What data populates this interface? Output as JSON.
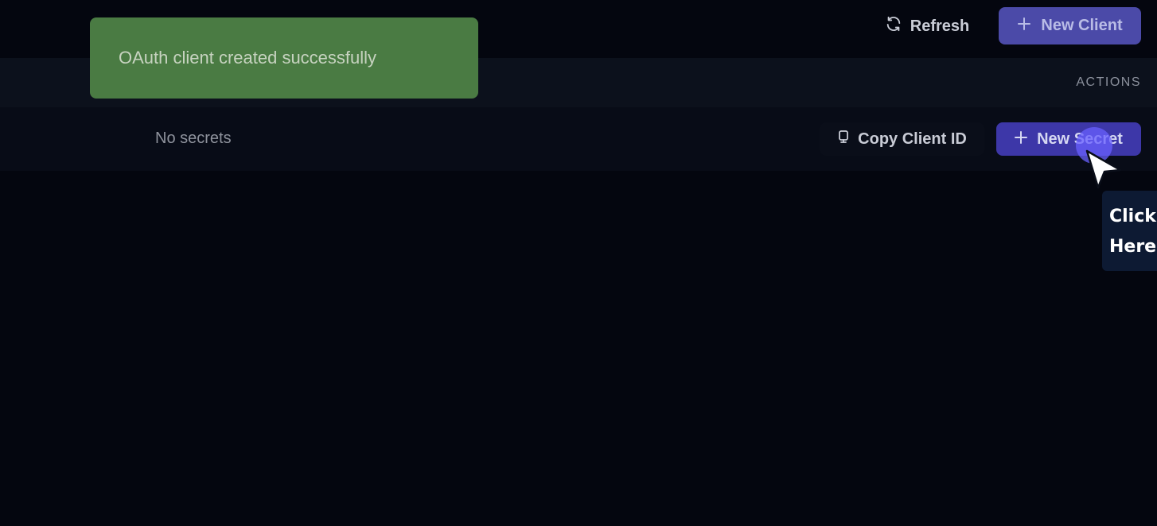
{
  "toolbar": {
    "refresh_label": "Refresh",
    "refresh_icon": "refresh-icon",
    "new_client_label": "New Client",
    "new_client_icon": "plus-icon"
  },
  "table": {
    "columns": [
      "ACTIONS"
    ],
    "rows": [
      {
        "secrets_text": "No secrets",
        "copy_label": "Copy Client ID",
        "copy_icon": "clipboard-icon",
        "new_secret_label": "New Secret",
        "new_secret_icon": "plus-icon"
      }
    ]
  },
  "toast": {
    "message": "OAuth client created successfully"
  },
  "tooltip": {
    "line1": "Click",
    "line2": "Here"
  },
  "colors": {
    "background": "#04060f",
    "primary_button": "#4b4aa8",
    "toast_success": "#4a7b43",
    "tooltip_bg": "#0d1a33"
  }
}
